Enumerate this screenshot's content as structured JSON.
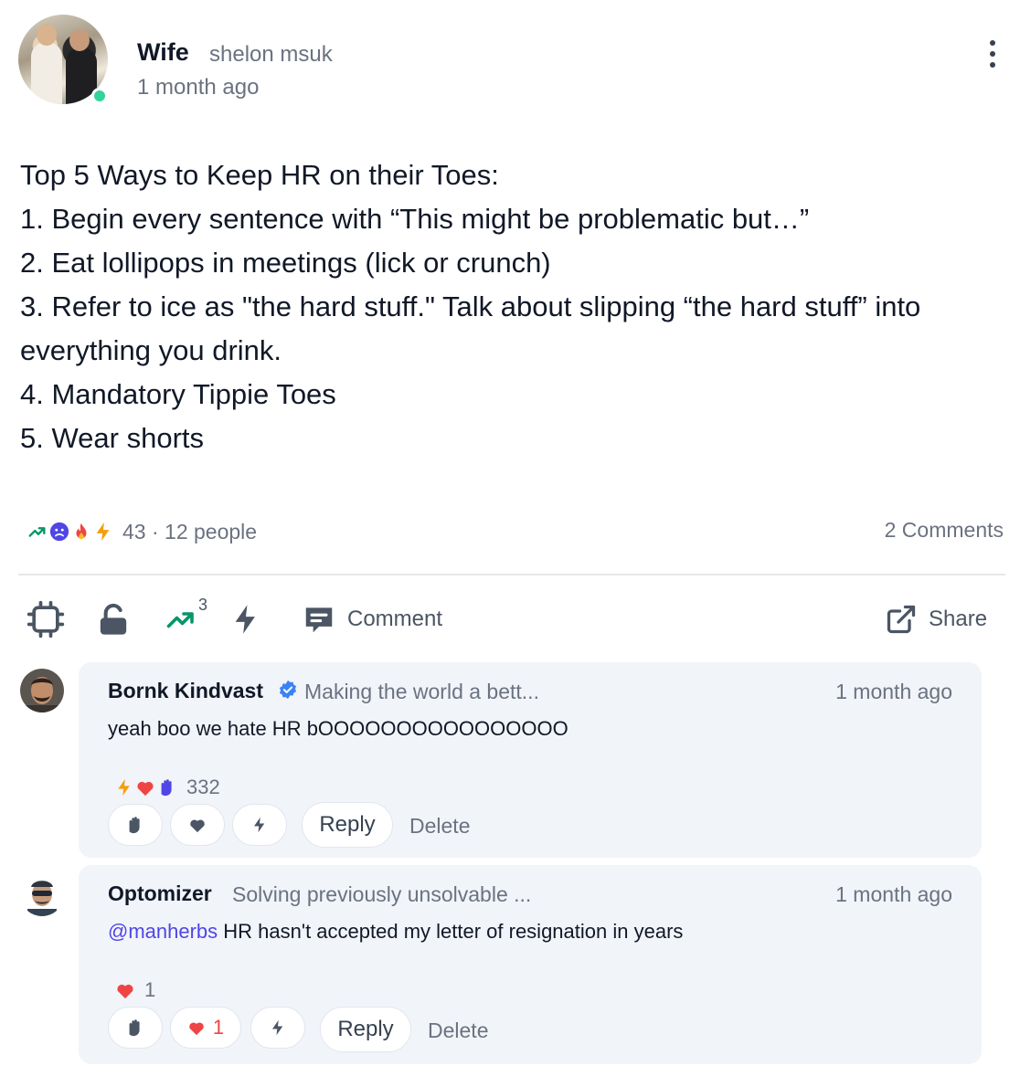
{
  "post": {
    "author_name": "Wife",
    "author_handle": "shelon msuk",
    "time": "1 month ago",
    "body_lines": [
      "Top 5 Ways to Keep HR on their Toes:",
      "1. Begin every sentence with “This might be problematic but…”",
      "2. Eat lollipops in meetings (lick or crunch)",
      "3. Refer to ice as \"the hard stuff.\" Talk about slipping “the hard stuff” into",
      "everything you drink.",
      "4. Mandatory Tippie Toes",
      "5. Wear shorts"
    ],
    "reaction_summary": "43 · 12 people",
    "comments_count": "2 Comments"
  },
  "actions": {
    "trending_count": "3",
    "comment_label": "Comment",
    "share_label": "Share"
  },
  "comments": [
    {
      "name": "Bornk Kindvast",
      "verified": true,
      "bio": "Making the world a bett...",
      "time": "1 month ago",
      "text": "yeah boo we hate HR bOOOOOOOOOOOOOOOO",
      "reaction_total": "332",
      "reply_label": "Reply",
      "delete_label": "Delete"
    },
    {
      "name": "Optomizer",
      "bio": "Solving previously unsolvable ...",
      "time": "1 month ago",
      "mention": "@manherbs",
      "text": " HR hasn't accepted my letter of resignation in years",
      "reaction_total": "1",
      "heart_count": "1",
      "reply_label": "Reply",
      "delete_label": "Delete"
    }
  ],
  "colors": {
    "accent": "#4f46e5",
    "online": "#34d399",
    "trending": "#059669",
    "heart": "#ef4444",
    "bolt": "#f59e0b",
    "fire": "#ef4444",
    "verified": "#3b82f6",
    "card_bg": "#f1f4f9"
  },
  "icons": [
    "chip-icon",
    "unlock-icon",
    "trending-icon",
    "bolt-icon",
    "comment-icon",
    "share-icon",
    "hand-icon",
    "heart-icon",
    "sad-face-icon",
    "fire-icon",
    "verified-icon",
    "more-icon"
  ]
}
